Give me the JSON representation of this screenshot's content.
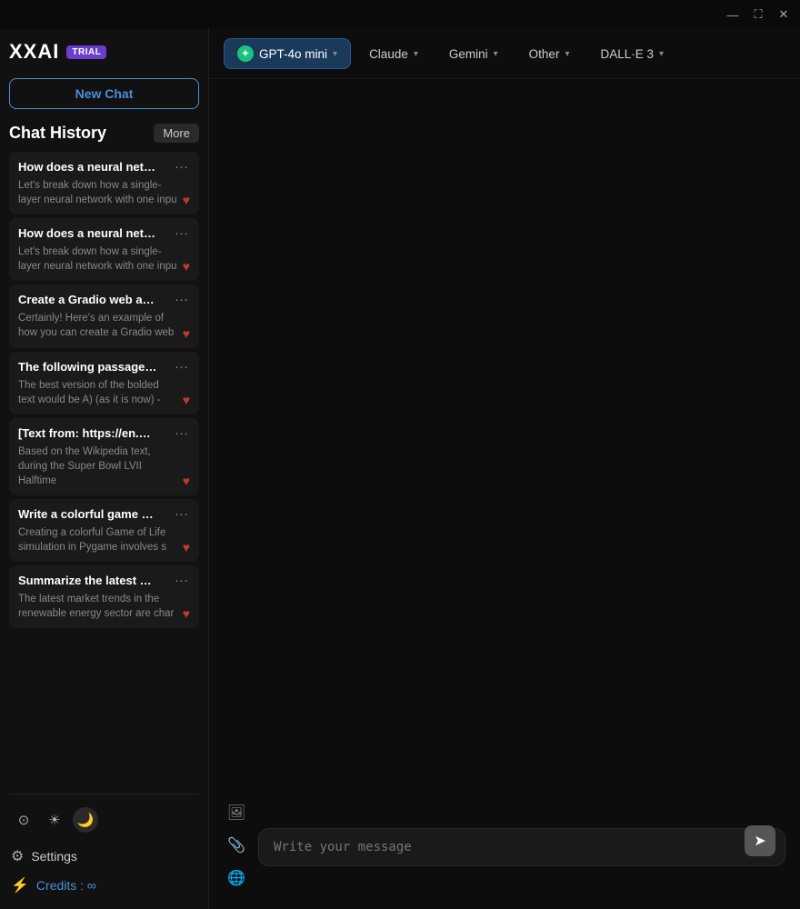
{
  "app": {
    "name": "XXAI",
    "badge": "TRIAL"
  },
  "titlebar": {
    "minimize": "—",
    "maximize": "⛶",
    "close": "✕"
  },
  "sidebar": {
    "new_chat_label": "New Chat",
    "chat_history_label": "Chat History",
    "more_label": "More",
    "chat_items": [
      {
        "title": "How does a neural netw...",
        "menu": "···",
        "preview": "Let's break down how a single-layer neural network with one inpu",
        "heart": "♥"
      },
      {
        "title": "How does a neural netw...",
        "menu": "···",
        "preview": "Let's break down how a single-layer neural network with one inpu",
        "heart": "♥"
      },
      {
        "title": "Create a Gradio web ap...",
        "menu": "···",
        "preview": "Certainly! Here's an example of how you can create a Gradio web",
        "heart": "♥"
      },
      {
        "title": "The following passage is...",
        "menu": "···",
        "preview": "The best version of the bolded text would be A) (as it is now) -",
        "heart": "♥"
      },
      {
        "title": "[Text from: https://en.wi...",
        "menu": "···",
        "preview": "Based on the Wikipedia text, during the Super Bowl LVII Halftime",
        "heart": "♥"
      },
      {
        "title": "Write a colorful game of...",
        "menu": "···",
        "preview": "Creating a colorful Game of Life simulation in Pygame involves s",
        "heart": "♥"
      },
      {
        "title": "Summarize the latest m...",
        "menu": "···",
        "preview": "The latest market trends in the renewable energy sector are char",
        "heart": "♥"
      }
    ],
    "settings_label": "Settings",
    "credits_label": "Credits : ∞"
  },
  "models": [
    {
      "id": "gpt4o-mini",
      "label": "GPT-4o mini",
      "active": true,
      "has_icon": true
    },
    {
      "id": "claude",
      "label": "Claude",
      "active": false,
      "has_icon": false
    },
    {
      "id": "gemini",
      "label": "Gemini",
      "active": false,
      "has_icon": false
    },
    {
      "id": "other",
      "label": "Other",
      "active": false,
      "has_icon": false
    },
    {
      "id": "dalle3",
      "label": "DALL·E 3",
      "active": false,
      "has_icon": false
    }
  ],
  "input": {
    "placeholder": "Write your message"
  },
  "icons": {
    "image": "🖼",
    "paperclip": "📎",
    "globe": "🌐",
    "send": "➤",
    "gear": "⚙",
    "light": "☀",
    "dark": "🌙",
    "custom1": "⊙",
    "credits_icon": "⚡"
  }
}
